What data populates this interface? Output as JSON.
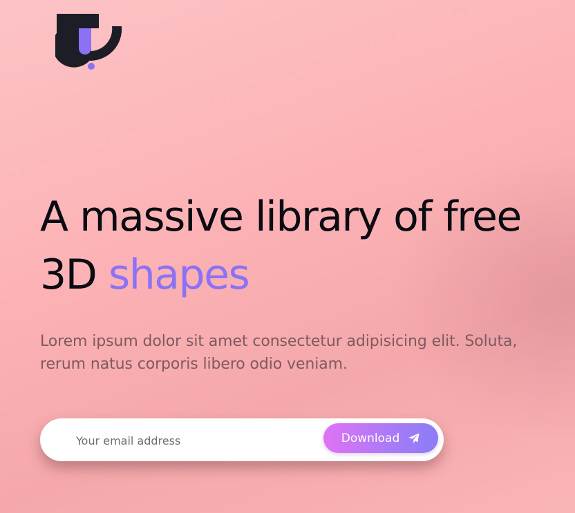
{
  "brand": {
    "logo_icon": "brand-logo-icon",
    "logo_dark_color": "#1c1d26",
    "logo_accent_color": "#8b72f4"
  },
  "hero": {
    "headline_before": "A massive library of free 3D ",
    "headline_accent": "shapes",
    "accent_color": "#8b72f4",
    "description": "Lorem ipsum dolor sit amet consectetur adipisicing elit. Soluta, rerum natus corporis libero odio veniam."
  },
  "signup": {
    "email_placeholder": "Your email address",
    "email_value": "",
    "button_label": "Download",
    "button_icon": "paper-plane-icon",
    "button_gradient": [
      "#e072f5",
      "#8c7cf6"
    ]
  }
}
